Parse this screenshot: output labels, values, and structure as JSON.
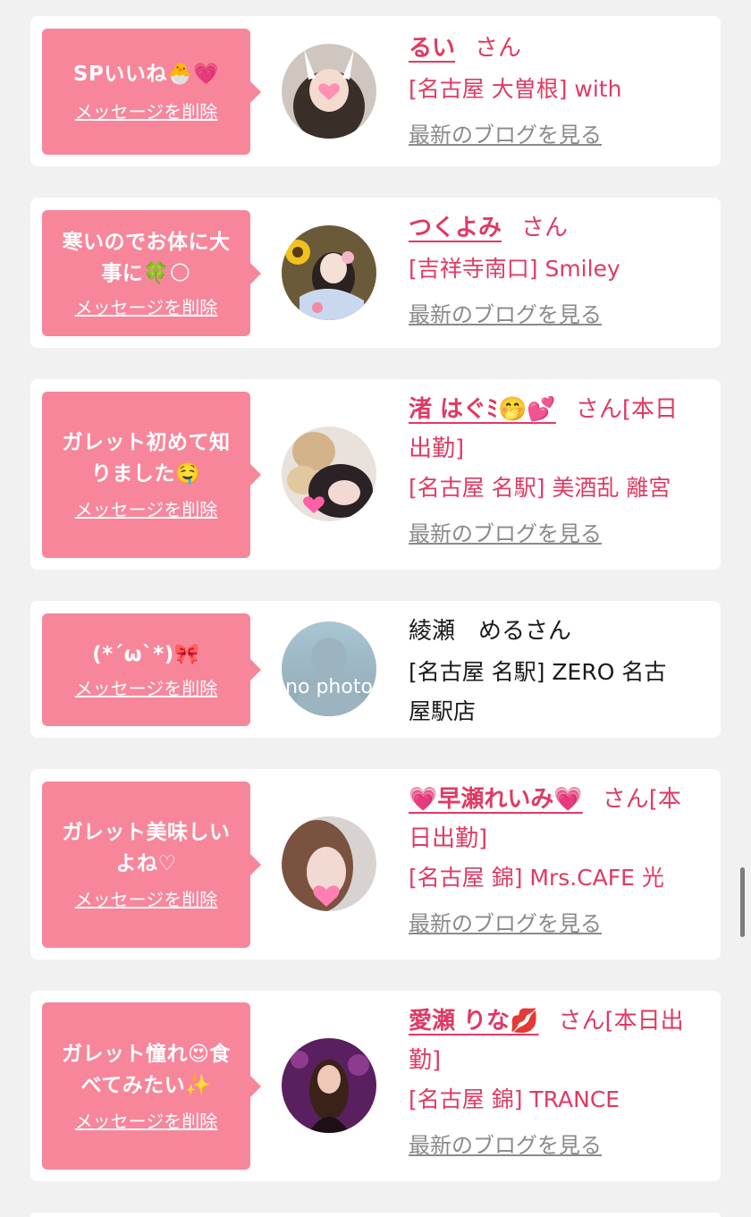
{
  "delete_label": "メッセージを削除",
  "san_label": "さん",
  "blog_label": "最新のブログを見る",
  "colors": {
    "bubble": "#f7869b",
    "name": "#e03a63",
    "blog_link": "#8a8a8a",
    "background": "#f1f1f1"
  },
  "cards": [
    {
      "message_lines": [
        "SPいいね🐣💗"
      ],
      "name": "るい",
      "name_suffix": "",
      "status": "",
      "shop_lines": [
        "[名古屋 大曽根] with"
      ],
      "has_blog": true
    },
    {
      "message_lines": [
        "寒いのでお体に大",
        "事に🍀🌕"
      ],
      "name": "つくよみ",
      "name_suffix": "",
      "status": "",
      "shop_lines": [
        "[吉祥寺南口] Smiley"
      ],
      "has_blog": true
    },
    {
      "message_lines": [
        "ガレット初めて知",
        "りました🤤"
      ],
      "name": "渚 はぐ",
      "name_suffix": "ﾐ🤭💕",
      "status_lines": [
        "[本日",
        "出勤]"
      ],
      "shop_lines": [
        "[名古屋 名駅] 美酒乱 離宮"
      ],
      "has_blog": true
    },
    {
      "message_lines": [
        "(*´ω`*)🎀"
      ],
      "name": "綾瀬　める",
      "name_suffix": "",
      "status": "",
      "shop_lines": [
        "[名古屋 名駅] ZERO 名古",
        "屋駅店"
      ],
      "has_blog": false,
      "avatar_text": "no photo"
    },
    {
      "message_lines": [
        "ガレット美味しい",
        "よね♡"
      ],
      "name": "💗早瀬れいみ💗",
      "name_suffix": "",
      "status_lines": [
        "[本",
        "日出勤]"
      ],
      "shop_lines": [
        "[名古屋 錦] Mrs.CAFE 光"
      ],
      "has_blog": true
    },
    {
      "message_lines": [
        "ガレット憧れ😍食",
        "べてみたい✨"
      ],
      "name": "愛瀬 りな",
      "name_suffix": "💋",
      "status_lines": [
        "[本日出",
        "勤]"
      ],
      "shop_lines": [
        "[名古屋 錦] TRANCE"
      ],
      "has_blog": true
    }
  ]
}
